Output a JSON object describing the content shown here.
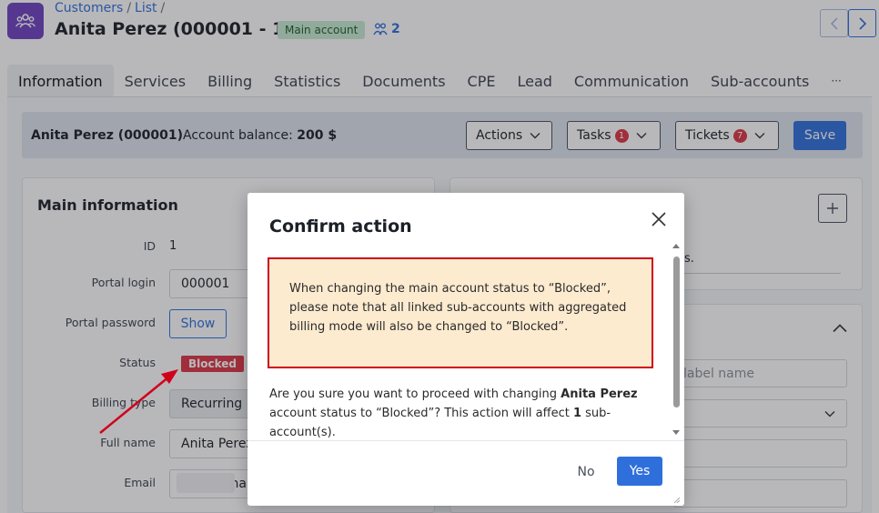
{
  "breadcrumb": {
    "customers": "Customers",
    "list": "List",
    "sep": "/"
  },
  "header": {
    "title": "Anita Perez (000001 - 1)",
    "badge": "Main account",
    "subaccounts_count": "2"
  },
  "tabs": [
    {
      "label": "Information"
    },
    {
      "label": "Services"
    },
    {
      "label": "Billing"
    },
    {
      "label": "Statistics"
    },
    {
      "label": "Documents"
    },
    {
      "label": "CPE"
    },
    {
      "label": "Lead"
    },
    {
      "label": "Communication"
    },
    {
      "label": "Sub-accounts"
    },
    {
      "label": "···"
    }
  ],
  "account_bar": {
    "name": "Anita Perez (000001)",
    "balance_label": "Account balance:",
    "balance_value": "200 $",
    "actions_label": "Actions",
    "tasks_label": "Tasks",
    "tasks_count": "1",
    "tickets_label": "Tickets",
    "tickets_count": "7",
    "save_label": "Save"
  },
  "main_info": {
    "title": "Main information",
    "id_label": "ID",
    "id_value": "1",
    "portal_login_label": "Portal login",
    "portal_login_value": "000001",
    "portal_password_label": "Portal password",
    "show_label": "Show",
    "status_label": "Status",
    "status_value": "Blocked",
    "billing_type_label": "Billing type",
    "billing_type_value": "Recurring",
    "full_name_label": "Full name",
    "full_name_value": "Anita Perez",
    "email_label": "Email",
    "email_value_partial": "na"
  },
  "right_panel": {
    "text_fragment": "s.",
    "label_placeholder": "label name"
  },
  "modal": {
    "title": "Confirm action",
    "warning": "When changing the main account status to “Blocked”, please note that all linked sub-accounts with aggregated billing mode will also be changed to “Blocked”.",
    "question_pre": "Are you sure you want to proceed with changing ",
    "question_name": "Anita Perez",
    "question_mid": " account status to “Blocked”? This action will affect ",
    "question_count": "1",
    "question_post": " sub-account(s).",
    "no_label": "No",
    "yes_label": "Yes"
  },
  "colors": {
    "accent": "#2f6fdc",
    "status_blocked": "#dc3545",
    "warning_bg": "#fdebd0",
    "warning_border": "#d0021b",
    "app_icon": "#6f42c1",
    "main_badge_bg": "#c8ebd1"
  },
  "icons": {
    "app": "customers-icon",
    "subaccounts": "people-icon",
    "prev": "chevron-left-icon",
    "next": "chevron-right-icon",
    "close": "close-icon",
    "plus": "plus-icon",
    "chevron_down": "chevron-down-icon",
    "chevron_up": "chevron-up-icon"
  }
}
